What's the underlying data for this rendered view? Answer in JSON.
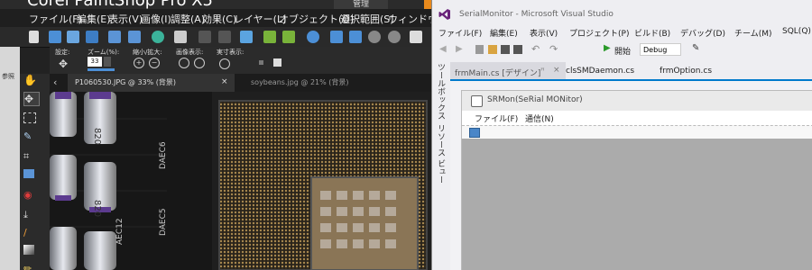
{
  "paintshop": {
    "title": "Corel PaintShop Pro X5",
    "ribbon_tabs": [
      "管理",
      "編集"
    ],
    "menu": [
      "ファイル(F)",
      "編集(E)",
      "表示(V)",
      "画像(I)",
      "調整(A)",
      "効果(C)",
      "レイヤー(L)",
      "オブジェクト(O)",
      "選択範囲(S)",
      "ウィンドウ"
    ],
    "options": {
      "preset_label": "設定:",
      "zoom_label": "ズーム(%):",
      "zoom_value": "33",
      "zoom_inout_label": "縮小/拡大:",
      "view_label": "画像表示:",
      "actual_label": "実寸表示:"
    },
    "doc_tabs": [
      {
        "label": "P1060530.JPG @ 33% (背景)",
        "close": "×"
      },
      {
        "label": "soybeans.jpg @ 21% (背景)"
      }
    ],
    "left_panel_label": "参照",
    "canvas_labels": {
      "daec6": "DAEC6",
      "daec5": "DAEC5",
      "daec12": "AEC12",
      "cap": "820"
    }
  },
  "vs": {
    "title": "SerialMonitor - Microsoft Visual Studio",
    "menu": [
      "ファイル(F)",
      "編集(E)",
      "表示(V)",
      "プロジェクト(P)",
      "ビルド(B)",
      "デバッグ(D)",
      "チーム(M)",
      "SQL(Q)"
    ],
    "toolbar": {
      "start_label": "開始",
      "config": "Debug"
    },
    "sidebar": [
      "ツールボックス",
      "リソース ビュー"
    ],
    "tabs": [
      {
        "label": "frmMain.cs [デザイン]",
        "pin": "ꟸ",
        "close": "×"
      },
      {
        "label": "clsSMDaemon.cs"
      },
      {
        "label": "frmOption.cs"
      }
    ],
    "form": {
      "title": "SRMon(SeRial MONitor)",
      "menu": [
        "ファイル(F)",
        "通信(N)"
      ]
    }
  }
}
